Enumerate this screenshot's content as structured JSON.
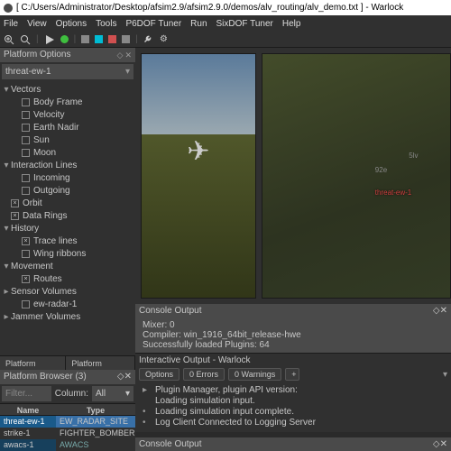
{
  "title": "[ C:/Users/Administrator/Desktop/afsim2.9/afsim2.9.0/demos/alv_routing/alv_demo.txt ] - Warlock",
  "menu": [
    "File",
    "View",
    "Options",
    "Tools",
    "P6DOF Tuner",
    "Run",
    "SixDOF Tuner",
    "Help"
  ],
  "platform_options": {
    "header": "Platform Options",
    "selector": "threat-ew-1",
    "tree": [
      {
        "lvl": 0,
        "tw": "▾",
        "label": "Vectors"
      },
      {
        "lvl": 1,
        "cb": false,
        "label": "Body Frame"
      },
      {
        "lvl": 1,
        "cb": false,
        "label": "Velocity"
      },
      {
        "lvl": 1,
        "cb": false,
        "label": "Earth Nadir"
      },
      {
        "lvl": 1,
        "cb": false,
        "label": "Sun"
      },
      {
        "lvl": 1,
        "cb": false,
        "label": "Moon"
      },
      {
        "lvl": 0,
        "tw": "▾",
        "label": "Interaction Lines"
      },
      {
        "lvl": 1,
        "cb": false,
        "label": "Incoming"
      },
      {
        "lvl": 1,
        "cb": false,
        "label": "Outgoing"
      },
      {
        "lvl": 0,
        "cb": true,
        "label": "Orbit"
      },
      {
        "lvl": 0,
        "cb": true,
        "label": "Data Rings"
      },
      {
        "lvl": 0,
        "tw": "▾",
        "label": "History"
      },
      {
        "lvl": 1,
        "cb": true,
        "label": "Trace lines"
      },
      {
        "lvl": 1,
        "cb": false,
        "label": "Wing ribbons"
      },
      {
        "lvl": 0,
        "tw": "▾",
        "label": "Movement"
      },
      {
        "lvl": 1,
        "cb": true,
        "label": "Routes"
      },
      {
        "lvl": 0,
        "tw": "▸",
        "label": "Sensor Volumes"
      },
      {
        "lvl": 1,
        "cb": false,
        "label": "ew-radar-1"
      },
      {
        "lvl": 0,
        "tw": "▸",
        "label": "Jammer Volumes"
      }
    ],
    "tabs": [
      "Platform Details",
      "Platform Options"
    ]
  },
  "browser": {
    "header": "Platform Browser (3)",
    "filter_placeholder": "Filter...",
    "column_label": "Column:",
    "column_value": "All",
    "cols": [
      "Name",
      "Type"
    ],
    "rows": [
      {
        "name": "threat-ew-1",
        "type": "EW_RADAR_SITE",
        "sel": true
      },
      {
        "name": "strike-1",
        "type": "FIGHTER_BOMBER",
        "sel": false
      },
      {
        "name": "awacs-1",
        "type": "AWACS",
        "sel": false
      }
    ]
  },
  "view2_labels": {
    "wp1": "92e",
    "wp2": "5lv",
    "red": "threat-ew-1"
  },
  "console": {
    "header": "Console Output",
    "lines": [
      "Mixer: 0",
      "Compiler: win_1916_64bit_release-hwe",
      "Successfully loaded Plugins: 64"
    ]
  },
  "io": {
    "header": "Interactive Output - Warlock",
    "tabs": [
      "Options",
      "0 Errors",
      "0 Warnings"
    ],
    "items": [
      "Plugin Manager, plugin API version:",
      "Loading simulation input.",
      "Loading simulation input complete.",
      "Log Client Connected to Logging Server"
    ]
  },
  "bottom_header": "Console Output"
}
